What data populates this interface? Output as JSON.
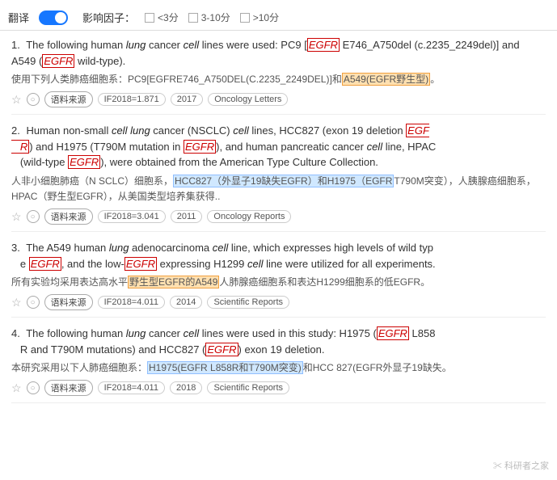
{
  "topbar": {
    "translate_label": "翻译",
    "toggle_state": "on",
    "filter_label": "影响因子：",
    "filters": [
      {
        "label": "<3分",
        "checked": false
      },
      {
        "label": "3-10分",
        "checked": false
      },
      {
        "label": ">10分",
        "checked": false
      }
    ]
  },
  "results": [
    {
      "number": "1.",
      "english": "The following human lung cancer cell lines were used: PC9 [EGFR E746_A750del (c.2235_2249del)] and A549 (EGFR wild-type).",
      "chinese": "使用下列人类肺癌细胞系：PC9[EGFRE746_A750DEL(C.2235_2249DEL)]和A549(EGFR野生型)。",
      "meta_source": "语料来源",
      "meta_if": "IF2018=1.871",
      "meta_year": "2017",
      "meta_journal": "Oncology Letters"
    },
    {
      "number": "2.",
      "english": "Human non-small cell lung cancer (NSCLC) cell lines, HCC827 (exon 19 deletion EGFR) and H1975 (T790M mutation in EGFR), and human pancreatic cancer cell line, HPAC (wild-type EGFR), were obtained from the American Type Culture Collection.",
      "chinese": "人非小细胞肺癌（N SCLC）细胞系，HCC827（外显子19缺失EGFR）和H1975（EGFR T790M突变），人胰腺癌细胞系，HPAC（野生型EGFR），从美国类型培养集获得..",
      "meta_source": "语料来源",
      "meta_if": "IF2018=3.041",
      "meta_year": "2011",
      "meta_journal": "Oncology Reports"
    },
    {
      "number": "3.",
      "english": "The A549 human lung adenocarcinoma cell line, which expresses high levels of wild type EGFR, and the low-EGFR expressing H1299 cell line were utilized for all experiments.",
      "chinese": "所有实验均采用表达高水平野生型EGFR的A549人肺腺癌细胞系和表达H1299细胞系的低EGFR。",
      "meta_source": "语料来源",
      "meta_if": "IF2018=4.011",
      "meta_year": "2014",
      "meta_journal": "Scientific Reports"
    },
    {
      "number": "4.",
      "english": "The following human lung cancer cell lines were used in this study: H1975 (EGFR L858R and T790M mutations) and HCC827 (EGFR exon 19 deletion.",
      "chinese": "本研究采用以下人肺癌细胞系：H1975(EGFR L858R和T790M突变)和HCC 827(EGFR外显子19缺失。",
      "meta_source": "语料来源",
      "meta_if": "IF2018=4.011",
      "meta_year": "2018",
      "meta_journal": "Scientific Reports"
    }
  ],
  "watermark": "✂ 科研者之家"
}
